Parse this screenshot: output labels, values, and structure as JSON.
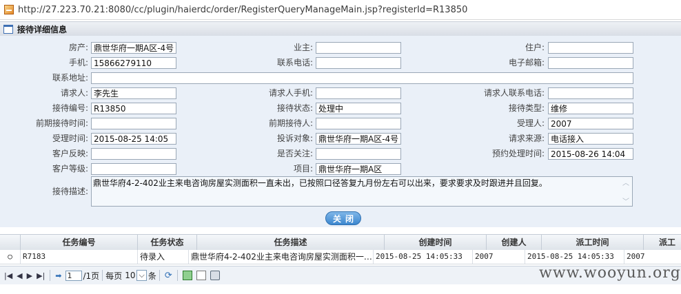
{
  "browser": {
    "url": "http://27.223.70.21:8080/cc/plugin/haierdc/order/RegisterQueryManageMain.jsp?registerId=R13850"
  },
  "panel": {
    "title": "接待详细信息"
  },
  "form": {
    "property_label": "房产:",
    "property_value": "鼎世华府一期A区-4号",
    "owner_label": "业主:",
    "owner_value": "",
    "resident_label": "住户:",
    "resident_value": "",
    "mobile_label": "手机:",
    "mobile_value": "15866279110",
    "phone_label": "联系电话:",
    "phone_value": "",
    "email_label": "电子邮箱:",
    "email_value": "",
    "address_label": "联系地址:",
    "address_value": "",
    "requester_label": "请求人:",
    "requester_value": "李先生",
    "requester_mobile_label": "请求人手机:",
    "requester_mobile_value": "",
    "requester_phone_label": "请求人联系电话:",
    "requester_phone_value": "",
    "reception_no_label": "接待编号:",
    "reception_no_value": "R13850",
    "reception_status_label": "接待状态:",
    "reception_status_value": "处理中",
    "reception_type_label": "接待类型:",
    "reception_type_value": "维修",
    "prev_time_label": "前期接待时间:",
    "prev_time_value": "",
    "prev_person_label": "前期接待人:",
    "prev_person_value": "",
    "handler_label": "受理人:",
    "handler_value": "2007",
    "accept_time_label": "受理时间:",
    "accept_time_value": "2015-08-25 14:05",
    "complaint_target_label": "投诉对象:",
    "complaint_target_value": "鼎世华府一期A区-4号",
    "request_source_label": "请求来源:",
    "request_source_value": "电话接入",
    "feedback_label": "客户反映:",
    "feedback_value": "",
    "attention_label": "是否关注:",
    "attention_value": "",
    "scheduled_time_label": "预约处理时间:",
    "scheduled_time_value": "2015-08-26 14:04",
    "level_label": "客户等级:",
    "level_value": "",
    "project_label": "项目:",
    "project_value": "鼎世华府一期A区",
    "description_label": "接待描述:",
    "description_value": "鼎世华府4-2-402业主来电咨询房屋实测面积一直未出，已按照口径答复九月份左右可以出来，要求要求及时跟进并且回复。",
    "close_button": "关闭"
  },
  "grid": {
    "columns": [
      "任务编号",
      "任务状态",
      "任务描述",
      "创建时间",
      "创建人",
      "派工时间",
      "派工"
    ],
    "rows": [
      {
        "radio": "○",
        "task_no": "R7183",
        "status": "待录入",
        "desc": "鼎世华府4-2-402业主来电咨询房屋实测面积一…",
        "created": "2015-08-25 14:05:33",
        "creator": "2007",
        "dispatch_time": "2015-08-25 14:05:33",
        "dispatcher": "2007"
      }
    ]
  },
  "pager": {
    "page_value": "1",
    "total_pages": "/1页",
    "per_page_label": "每页",
    "per_page_value": "10",
    "per_page_suffix": "条"
  },
  "watermark": "www.wooyun.org"
}
